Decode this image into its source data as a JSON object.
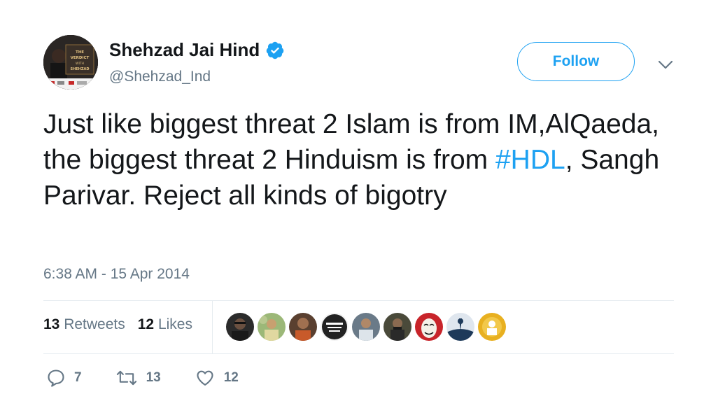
{
  "author": {
    "display_name": "Shehzad Jai Hind",
    "handle": "@Shehzad_Ind",
    "verified": true,
    "avatar_text": [
      "THE",
      "VERDICT",
      "WITH",
      "SHEHZAD"
    ]
  },
  "follow_label": "Follow",
  "tweet": {
    "text_before": "Just like biggest threat 2 Islam is from IM,AlQaeda, the biggest threat 2 Hinduism is from ",
    "hashtag": "#HDL",
    "text_after": ", Sangh Parivar. Reject all kinds of bigotry",
    "timestamp": "6:38 AM - 15 Apr 2014"
  },
  "stats": {
    "retweets_count": "13",
    "retweets_label": "Retweets",
    "likes_count": "12",
    "likes_label": "Likes"
  },
  "likers": [
    {
      "name": "liker-1",
      "color": "#2b2b2b"
    },
    {
      "name": "liker-2",
      "color": "#8fa86a"
    },
    {
      "name": "liker-3",
      "color": "#6b4a32"
    },
    {
      "name": "liker-4",
      "color": "#3a3a3a"
    },
    {
      "name": "liker-5",
      "color": "#5a6a7a"
    },
    {
      "name": "liker-6",
      "color": "#4a4a3a"
    },
    {
      "name": "liker-7",
      "color": "#c8242a"
    },
    {
      "name": "liker-8",
      "color": "#1e3a5a"
    },
    {
      "name": "liker-9",
      "color": "#e8b020"
    }
  ],
  "actions": {
    "replies": "7",
    "retweets": "13",
    "likes": "12"
  },
  "colors": {
    "accent": "#1da1f2",
    "secondary_text": "#657786",
    "primary_text": "#14171a",
    "divider": "#e6ecf0"
  },
  "icons": [
    "verified-badge-icon",
    "chevron-down-icon",
    "reply-icon",
    "retweet-icon",
    "heart-icon"
  ]
}
